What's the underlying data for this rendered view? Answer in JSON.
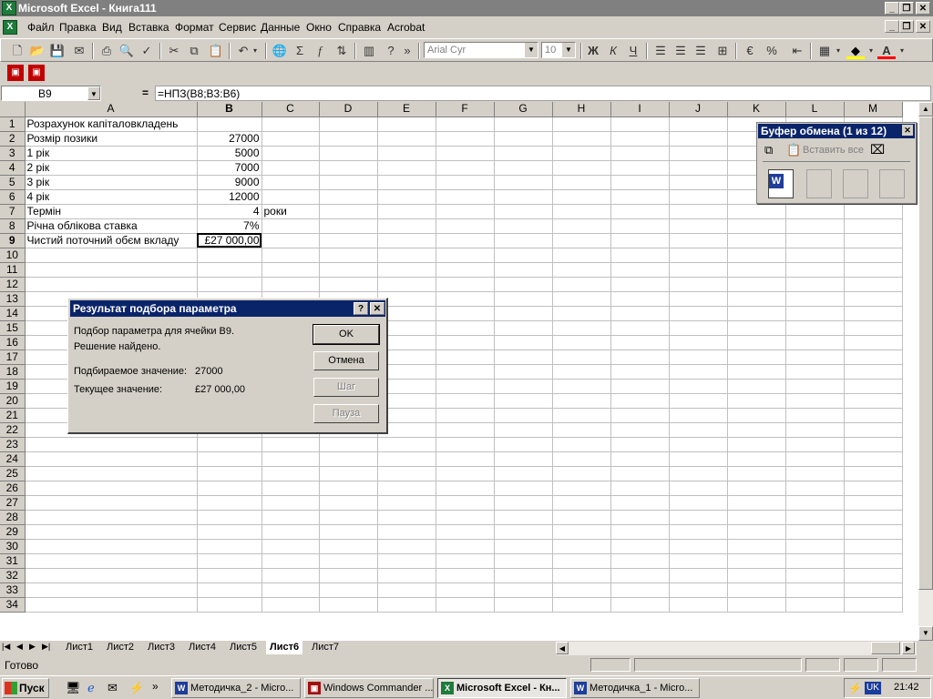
{
  "window": {
    "title": "Microsoft Excel - Книга111"
  },
  "menu": [
    "Файл",
    "Правка",
    "Вид",
    "Вставка",
    "Формат",
    "Сервис",
    "Данные",
    "Окно",
    "Справка",
    "Acrobat"
  ],
  "toolbar": {
    "font_name": "Arial Cyr",
    "font_size": "10"
  },
  "formula_bar": {
    "name_box": "B9",
    "equals": "=",
    "formula": "=НПЗ(B8;B3:B6)"
  },
  "columns": [
    "A",
    "B",
    "C",
    "D",
    "E",
    "F",
    "G",
    "H",
    "I",
    "J",
    "K",
    "L",
    "M"
  ],
  "rows": [
    {
      "n": "1",
      "a": "Розрахунок капіталовкладень",
      "b": "",
      "c": ""
    },
    {
      "n": "2",
      "a": "Розмір позики",
      "b": "27000",
      "c": ""
    },
    {
      "n": "3",
      "a": "1 рік",
      "b": "5000",
      "c": ""
    },
    {
      "n": "4",
      "a": "2 рік",
      "b": "7000",
      "c": ""
    },
    {
      "n": "5",
      "a": "3 рік",
      "b": "9000",
      "c": ""
    },
    {
      "n": "6",
      "a": "4 рік",
      "b": "12000",
      "c": ""
    },
    {
      "n": "7",
      "a": "Термін",
      "b": "4",
      "c": "роки"
    },
    {
      "n": "8",
      "a": "Річна облікова ставка",
      "b": "7%",
      "c": ""
    },
    {
      "n": "9",
      "a": "Чистий поточний обєм вкладу",
      "b": "£27 000,00",
      "c": ""
    },
    {
      "n": "10"
    },
    {
      "n": "11"
    },
    {
      "n": "12"
    },
    {
      "n": "13"
    },
    {
      "n": "14"
    },
    {
      "n": "15"
    },
    {
      "n": "16"
    },
    {
      "n": "17"
    },
    {
      "n": "18"
    },
    {
      "n": "19"
    },
    {
      "n": "20"
    },
    {
      "n": "21"
    },
    {
      "n": "22"
    },
    {
      "n": "23"
    },
    {
      "n": "24"
    },
    {
      "n": "25"
    },
    {
      "n": "26"
    },
    {
      "n": "27"
    },
    {
      "n": "28"
    },
    {
      "n": "29"
    },
    {
      "n": "30"
    },
    {
      "n": "31"
    },
    {
      "n": "32"
    },
    {
      "n": "33"
    },
    {
      "n": "34"
    }
  ],
  "clipboard": {
    "title": "Буфер обмена (1 из 12)",
    "paste_all": "Вставить все"
  },
  "dialog": {
    "title": "Результат подбора параметра",
    "line1": "Подбор параметра для ячейки B9.",
    "line2": "Решение найдено.",
    "target_label": "Подбираемое значение:",
    "target_value": "27000",
    "current_label": "Текущее значение:",
    "current_value": "£27 000,00",
    "ok": "OK",
    "cancel": "Отмена",
    "step": "Шаг",
    "pause": "Пауза"
  },
  "sheet_tabs": [
    "Лист1",
    "Лист2",
    "Лист3",
    "Лист4",
    "Лист5",
    "Лист6",
    "Лист7"
  ],
  "active_tab": "Лист6",
  "status": {
    "text": "Готово"
  },
  "taskbar": {
    "start": "Пуск",
    "tasks": [
      "Методичка_2 - Micro...",
      "Windows Commander ...",
      "Microsoft Excel - Кн...",
      "Методичка_1 - Micro..."
    ],
    "lang": "UK",
    "clock": "21:42"
  }
}
